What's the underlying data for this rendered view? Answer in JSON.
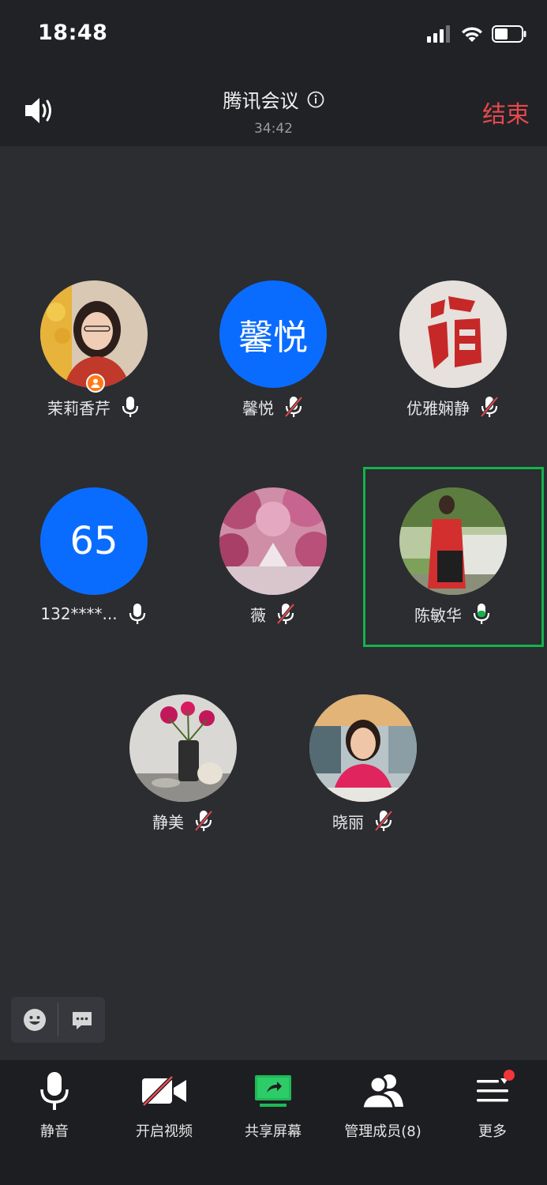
{
  "status_bar": {
    "time": "18:48"
  },
  "header": {
    "title": "腾讯会议",
    "timer": "34:42",
    "end_label": "结束"
  },
  "participants": [
    {
      "name": "茉莉香芹",
      "avatar": "photo",
      "mic": "on",
      "host": true
    },
    {
      "name": "馨悦",
      "avatar_text": "馨悦",
      "mic": "muted"
    },
    {
      "name": "优雅娴静",
      "avatar": "photo",
      "mic": "muted"
    },
    {
      "name": "132****...",
      "avatar_text": "65",
      "mic": "on"
    },
    {
      "name": "薇",
      "avatar": "photo",
      "mic": "muted"
    },
    {
      "name": "陈敏华",
      "avatar": "photo",
      "mic": "speaking",
      "active_speaker": true
    },
    {
      "name": "静美",
      "avatar": "photo",
      "mic": "muted"
    },
    {
      "name": "晓丽",
      "avatar": "photo",
      "mic": "muted"
    }
  ],
  "colors": {
    "accent_blue": "#0a6cff",
    "end_red": "#e5484d",
    "speaking_green": "#13b34a",
    "background": "#2b2d31"
  },
  "toolbar": {
    "mute_label": "静音",
    "video_label": "开启视频",
    "share_label": "共享屏幕",
    "members_label": "管理成员(8)",
    "more_label": "更多"
  },
  "icons": {
    "speaker": "speaker-icon",
    "info": "info-icon",
    "emoji": "emoji-icon",
    "chat": "chat-icon",
    "mic": "microphone-icon",
    "video_off": "video-off-icon",
    "share": "share-screen-icon",
    "members": "members-icon",
    "more": "menu-icon"
  }
}
